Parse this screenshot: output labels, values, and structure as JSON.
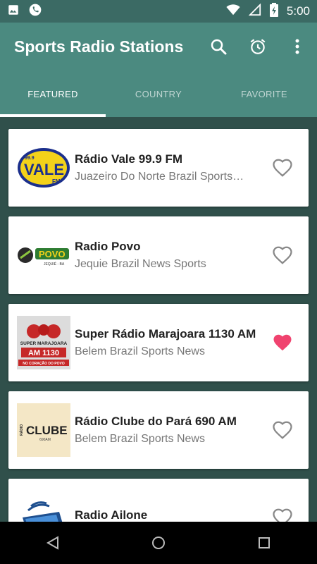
{
  "status_bar": {
    "time": "5:00",
    "icons": [
      "image-icon",
      "phone-icon",
      "wifi-icon",
      "signal-icon",
      "battery-charging-icon"
    ]
  },
  "app_bar": {
    "title": "Sports Radio Stations",
    "actions": [
      "search-icon",
      "alarm-clock-icon",
      "more-vert-icon"
    ]
  },
  "tabs": [
    {
      "label": "FEATURED",
      "active": true
    },
    {
      "label": "COUNTRY",
      "active": false
    },
    {
      "label": "FAVORITE",
      "active": false
    }
  ],
  "stations": [
    {
      "name": "Rádio Vale 99.9 FM",
      "description": "Juazeiro Do Norte Brazil Sports…",
      "favorite": false,
      "logo": {
        "line1": "99.9",
        "line2": "VALE",
        "line3": "FM"
      }
    },
    {
      "name": "Radio Povo",
      "description": "Jequie Brazil News Sports",
      "favorite": false,
      "logo": {
        "line1": "POVO",
        "line2": "JEQUIÉ - BA"
      }
    },
    {
      "name": "Super Rádio Marajoara 1130 AM",
      "description": "Belem Brazil Sports News",
      "favorite": true,
      "logo": {
        "line1": "SUPER MARAJOARA",
        "line2": "AM 1130",
        "line3": "NO CORAÇÃO DO POVO"
      }
    },
    {
      "name": "Rádio Clube do Pará 690 AM",
      "description": "Belem Brazil Sports News",
      "favorite": false,
      "logo": {
        "line1": "RÁDIO",
        "line2": "CLUBE",
        "line3": "690AM"
      }
    },
    {
      "name": "Radio Ailone",
      "description": "",
      "favorite": false,
      "logo": {}
    }
  ],
  "colors": {
    "status_bar": "#3b6a64",
    "app_bar": "#4b8a80",
    "content_bg": "#30504b",
    "favorite_active": "#f0436f",
    "favorite_inactive": "#888888"
  }
}
